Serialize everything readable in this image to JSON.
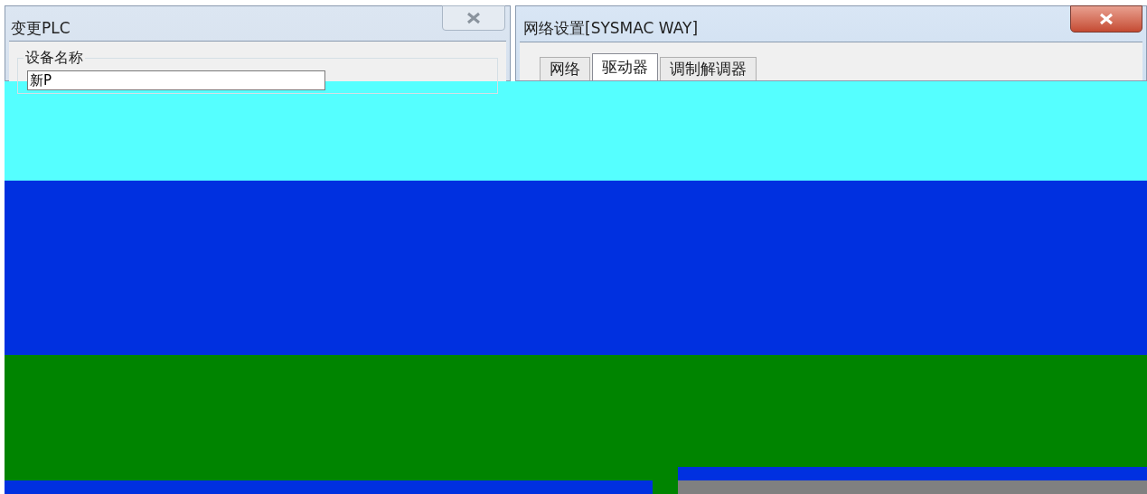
{
  "left_dialog": {
    "title": "变更PLC",
    "group_label": "设备名称",
    "device_name_value": "新P"
  },
  "right_dialog": {
    "title": "网络设置[SYSMAC WAY]",
    "tabs": [
      {
        "label": "网络",
        "selected": false
      },
      {
        "label": "驱动器",
        "selected": true
      },
      {
        "label": "调制解调器",
        "selected": false
      }
    ]
  }
}
